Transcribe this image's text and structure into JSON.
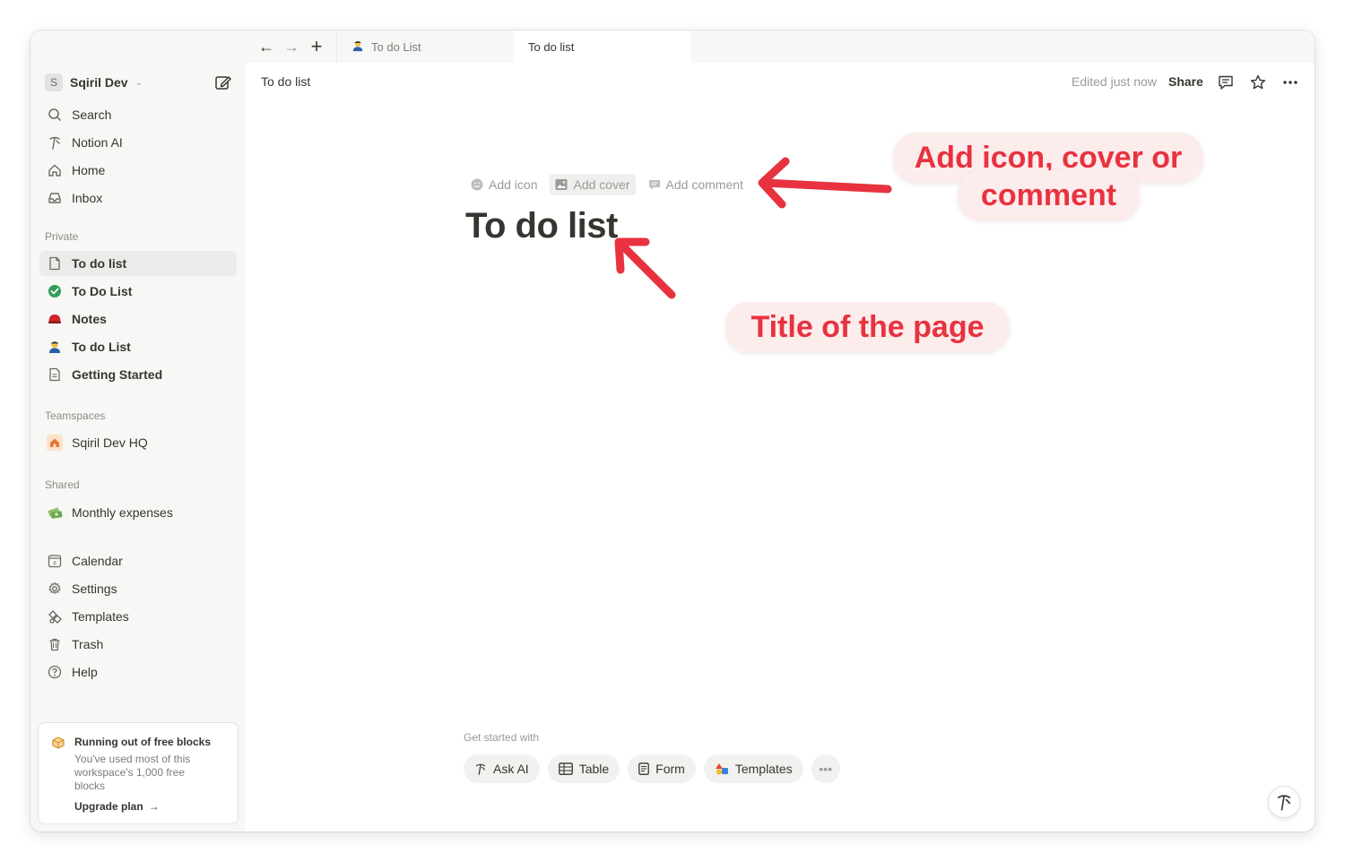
{
  "workspace": {
    "avatar": "S",
    "name": "Sqiril Dev"
  },
  "nav": [
    {
      "label": "Search",
      "icon": "search-icon"
    },
    {
      "label": "Notion AI",
      "icon": "notion-ai-icon"
    },
    {
      "label": "Home",
      "icon": "home-icon"
    },
    {
      "label": "Inbox",
      "icon": "inbox-icon"
    }
  ],
  "sections": {
    "private": "Private",
    "teamspaces": "Teamspaces",
    "shared": "Shared"
  },
  "private_pages": [
    {
      "label": "To do list",
      "icon": "page-icon"
    },
    {
      "label": "To Do List",
      "icon": "check-circle-icon"
    },
    {
      "label": "Notes",
      "icon": "red-dome-icon"
    },
    {
      "label": "To do List",
      "icon": "person-emoji-icon"
    },
    {
      "label": "Getting Started",
      "icon": "page-icon"
    }
  ],
  "teamspaces": [
    {
      "label": "Sqiril Dev HQ",
      "icon": "house-icon"
    }
  ],
  "shared_pages": [
    {
      "label": "Monthly expenses",
      "icon": "money-icon"
    }
  ],
  "tools": [
    {
      "label": "Calendar",
      "icon": "calendar-icon"
    },
    {
      "label": "Settings",
      "icon": "gear-icon"
    },
    {
      "label": "Templates",
      "icon": "templates-icon"
    },
    {
      "label": "Trash",
      "icon": "trash-icon"
    },
    {
      "label": "Help",
      "icon": "help-icon"
    }
  ],
  "calendar_day": "8",
  "promo": {
    "title": "Running out of free blocks",
    "body": "You've used most of this workspace's 1,000 free blocks",
    "link": "Upgrade plan"
  },
  "tabs": [
    {
      "label": "To do List"
    },
    {
      "label": "To do list"
    }
  ],
  "topbar": {
    "breadcrumb": "To do list",
    "edited": "Edited just now",
    "share": "Share"
  },
  "page": {
    "actions": {
      "add_icon": "Add icon",
      "add_cover": "Add cover",
      "add_comment": "Add comment"
    },
    "title": "To do list"
  },
  "get_started": {
    "label": "Get started with",
    "buttons": [
      {
        "label": "Ask AI",
        "icon": "notion-ai-icon"
      },
      {
        "label": "Table",
        "icon": "table-icon"
      },
      {
        "label": "Form",
        "icon": "form-icon"
      },
      {
        "label": "Templates",
        "icon": "templates-color-icon"
      }
    ]
  },
  "annotations": {
    "callout1_line1": "Add icon, cover or",
    "callout1_line2": "comment",
    "callout2": "Title of the page",
    "color": "#e8323f"
  }
}
